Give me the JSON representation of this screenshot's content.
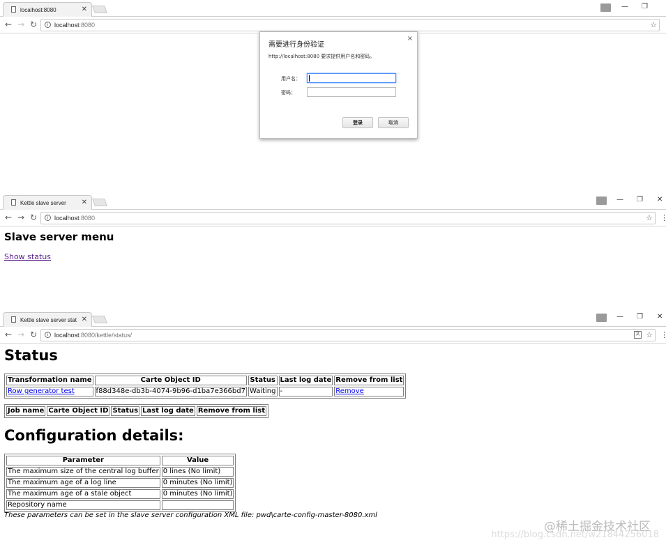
{
  "window1": {
    "tab_title": "localhost:8080",
    "url_host": "localhost",
    "url_rest": ":8080",
    "auth_dialog": {
      "title": "需要进行身份验证",
      "message": "http://localhost:8080 要求提供用户名和密码。",
      "username_label": "用户名：",
      "password_label": "密码：",
      "login_button": "登录",
      "cancel_button": "取消",
      "close_glyph": "×"
    }
  },
  "window2": {
    "tab_title": "Kettle slave server",
    "url_host": "localhost",
    "url_rest": ":8080",
    "heading": "Slave server menu",
    "show_status_link": "Show status"
  },
  "window3": {
    "tab_title": "Kettle slave server stat",
    "url_host": "localhost",
    "url_rest": ":8080/kettle/status/",
    "status_heading": "Status",
    "transformation_table": {
      "headers": [
        "Transformation name",
        "Carte Object ID",
        "Status",
        "Last log date",
        "Remove from list"
      ],
      "rows": [
        [
          "Row generator test",
          "f88d348e-db3b-4074-9b96-d1ba7e366bd7",
          "Waiting",
          "-",
          "Remove"
        ]
      ]
    },
    "job_table": {
      "headers": [
        "Job name",
        "Carte Object ID",
        "Status",
        "Last log date",
        "Remove from list"
      ]
    },
    "config_heading": "Configuration details:",
    "config_table": {
      "headers": [
        "Parameter",
        "Value"
      ],
      "rows": [
        [
          "The maximum size of the central log buffer",
          "0 lines (No limit)"
        ],
        [
          "The maximum age of a log line",
          "0 minutes (No limit)"
        ],
        [
          "The maximum age of a stale object",
          "0 minutes (No limit)"
        ],
        [
          "Repository name",
          ""
        ]
      ]
    },
    "config_note": "These parameters can be set in the slave server configuration XML file: pwd\\carte-config-master-8080.xml"
  },
  "watermark": {
    "primary": "@稀土掘金技术社区",
    "secondary": "https://blog.csdn.net/w21844256018"
  },
  "icons": {
    "window_controls": [
      "minimize-icon",
      "restore-icon",
      "close-icon"
    ],
    "nav": [
      "back-icon",
      "forward-icon",
      "reload-icon"
    ],
    "colors": {
      "link": "#0000ee",
      "visited_link": "#551a8b",
      "focus": "#4d90fe"
    }
  }
}
